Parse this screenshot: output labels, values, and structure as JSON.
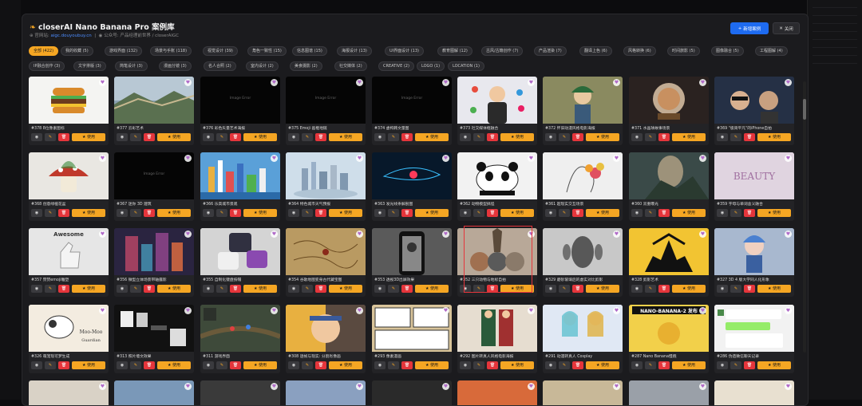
{
  "header": {
    "title": "closerAI Nano Banana Pro 案例库",
    "title_icon": "banana-icon",
    "site_label": "官网站:",
    "site_url": "aigc.douyoubuy.cn",
    "account_label": "公众号: 产品经理前世界 / closerAIGC",
    "new_case_label": "新增案例",
    "close_label": "关闭"
  },
  "chips": [
    {
      "label": "全部 (422)",
      "active": true
    },
    {
      "label": "我的收藏 (5)"
    },
    {
      "label": "游戏界面 (132)"
    },
    {
      "label": "场景与手账 (118)"
    },
    {
      "label": "视觉设计 (39)"
    },
    {
      "label": "角色一致性 (15)"
    },
    {
      "label": "信息图谱 (15)"
    },
    {
      "label": "海报设计 (13)"
    },
    {
      "label": "UI界面设计 (13)"
    },
    {
      "label": "教育图解 (12)"
    },
    {
      "label": "古风/古籍创作 (7)"
    },
    {
      "label": "产品渲染 (7)"
    },
    {
      "label": "翻译上色 (6)"
    },
    {
      "label": "风格转换 (6)"
    },
    {
      "label": "时间旅影 (5)"
    },
    {
      "label": "图像融合 (5)"
    },
    {
      "label": "工程图解 (4)"
    },
    {
      "label": "IP融合创作 (3)"
    },
    {
      "label": "文字排版 (3)"
    },
    {
      "label": "简笔设计 (3)"
    },
    {
      "label": "漫画分镜 (3)"
    },
    {
      "label": "名人合照 (2)"
    },
    {
      "label": "室内设计 (2)"
    },
    {
      "label": "美食摄影 (2)"
    },
    {
      "label": "社交媒体 (2)"
    },
    {
      "label": "CREATIVE (2)"
    },
    {
      "label": "LOGO (1)"
    },
    {
      "label": "LOCATION (1)"
    }
  ],
  "card_actions": {
    "use_label": "使用",
    "view_icon": "eye-icon",
    "edit_icon": "pencil-icon",
    "delete_icon": "trash-icon",
    "use_icon": "star-icon"
  },
  "image_error_text": "Image Error",
  "cards": [
    {
      "title": "#378 8位像素图标",
      "bg": "#f4f4f2",
      "art": "burger"
    },
    {
      "title": "#377 云彩艺术",
      "bg": "#8aa0b0",
      "art": "greatwall"
    },
    {
      "title": "#376 彩色矢量艺术海报",
      "bg": "#050505",
      "art": "error"
    },
    {
      "title": "#375 Emoji 画框地链",
      "bg": "#050505",
      "art": "error"
    },
    {
      "title": "#374 虚构韩文量图",
      "bg": "#050505",
      "art": "error"
    },
    {
      "title": "#373 社交媒体框融合",
      "bg": "#e8e8ee",
      "art": "boy"
    },
    {
      "title": "#372 怀旧动漫风格电影海报",
      "bg": "#7a7a55",
      "art": "anime"
    },
    {
      "title": "#371 水晶球故事场景",
      "bg": "#3a3230",
      "art": "globe"
    },
    {
      "title": "#369 \"极简平凡\"的iPhone自拍",
      "bg": "#2b3040",
      "art": "selfie"
    },
    {
      "title": "#368 创意绿植花盆",
      "bg": "#e9e7e2",
      "art": "mushroom"
    },
    {
      "title": "#367 迷你 3D 建筑",
      "bg": "#050505",
      "art": "error"
    },
    {
      "title": "#366 乐高城市景观",
      "bg": "#3f7fb8",
      "art": "city"
    },
    {
      "title": "#364 特色城市天气预报",
      "bg": "#c9d8e6",
      "art": "skyline"
    },
    {
      "title": "#363 发光线条解剖图",
      "bg": "#0a1a2a",
      "art": "shark"
    },
    {
      "title": "#362 动物模型搞怪",
      "bg": "#f2f2f2",
      "art": "panda"
    },
    {
      "title": "#361 超现实交互场景",
      "bg": "#ededed",
      "art": "sketch"
    },
    {
      "title": "#360 双重曝光",
      "bg": "#4a5a58",
      "art": "double"
    },
    {
      "title": "#359 字母与单词含义融合",
      "bg": "#ddd0dc",
      "art": "beauty"
    },
    {
      "title": "#357 赞赞emoji雕塑",
      "bg": "#e4e4e4",
      "art": "awesome"
    },
    {
      "title": "#356 微型立体场景带轴露影",
      "bg": "#2a2a3a",
      "art": "pixelcity"
    },
    {
      "title": "#355 自制化键盘按帽",
      "bg": "#d8d8d8",
      "art": "keycap"
    },
    {
      "title": "#354 谷歌地图变身古代藏宝图",
      "bg": "#b99a62",
      "art": "map"
    },
    {
      "title": "#353 透视3D出屏效果",
      "bg": "#606060",
      "art": "phone"
    },
    {
      "title": "#352 三只动物与地标自拍",
      "bg": "#b8a898",
      "art": "cats"
    },
    {
      "title": "#329 磨砂玻璃后的虚实对比剪影",
      "bg": "#c8c8c8",
      "art": "shadow"
    },
    {
      "title": "#328 剪影艺术",
      "bg": "#f2c432",
      "art": "dragon"
    },
    {
      "title": "#327 3D 4 版大学同人化形象",
      "bg": "#a8b8cf",
      "art": "chibi"
    },
    {
      "title": "#326 萌宠现可梦生成",
      "bg": "#f3ece0",
      "art": "cow"
    },
    {
      "title": "#313 照片墙文效果",
      "bg": "#111111",
      "art": "photos"
    },
    {
      "title": "#311 游戏界面",
      "bg": "#3e4a3a",
      "art": "moba"
    },
    {
      "title": "#308 逐帧与现实: 分割肖像画",
      "bg": "#887060",
      "art": "naruto"
    },
    {
      "title": "#293 像素漫画",
      "bg": "#d9c49a",
      "art": "comic"
    },
    {
      "title": "#292 图片转真人风格电影海报",
      "bg": "#e6ddd0",
      "art": "movieposter"
    },
    {
      "title": "#291 动漫转真人 Cosplay",
      "bg": "#e0e8f4",
      "art": "cosplay"
    },
    {
      "title": "#287 Nano Banana慢跑",
      "bg": "#f2d04a",
      "art": "banana"
    },
    {
      "title": "#286 伪造微信聊天记录",
      "bg": "#f2f2f2",
      "art": "chat"
    }
  ],
  "bottom_row_colors": [
    "#d9d2c6",
    "#7a98b8",
    "#3a3a3a",
    "#8aa0c0",
    "#2a2a2a",
    "#d86a3a",
    "#c8b898",
    "#9aa0a8",
    "#e8e0d0"
  ]
}
